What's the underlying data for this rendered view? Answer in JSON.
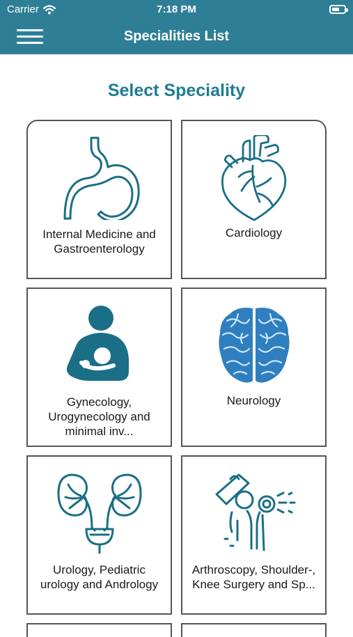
{
  "status_bar": {
    "carrier": "Carrier",
    "time": "7:18 PM"
  },
  "nav": {
    "title": "Specialities List"
  },
  "page": {
    "heading": "Select Speciality"
  },
  "specialities": [
    {
      "label": "Internal Medicine and Gastroenterology",
      "icon": "stomach-icon"
    },
    {
      "label": "Cardiology",
      "icon": "heart-icon"
    },
    {
      "label": "Gynecology, Urogynecology and minimal inv...",
      "icon": "mother-child-icon"
    },
    {
      "label": "Neurology",
      "icon": "brain-icon"
    },
    {
      "label": "Urology, Pediatric urology and Andrology",
      "icon": "kidneys-icon"
    },
    {
      "label": "Arthroscopy, Shoulder-, Knee Surgery and Sp...",
      "icon": "knee-joint-icon"
    }
  ],
  "colors": {
    "accent": "#2e7f96",
    "heading": "#1f7c93",
    "icon": "#1a6f86",
    "brain": "#2f7fc0"
  }
}
